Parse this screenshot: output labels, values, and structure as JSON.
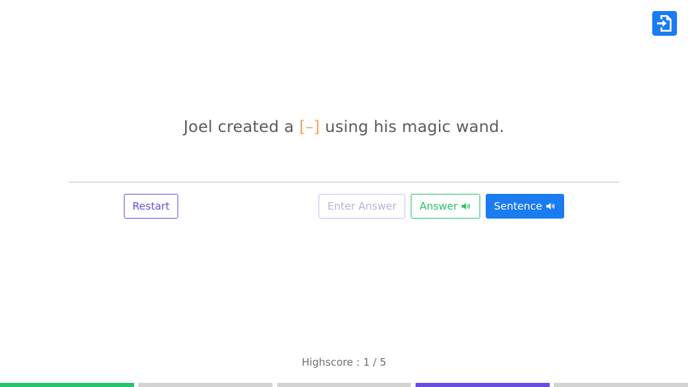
{
  "sentence": {
    "before": "Joel created a ",
    "blank": "[–]",
    "after": " using his magic wand."
  },
  "buttons": {
    "restart_label": "Restart",
    "answer_label": "Answer",
    "sentence_label": "Sentence"
  },
  "answer_input": {
    "placeholder": "Enter Answer",
    "value": ""
  },
  "highscore": {
    "text": "Highscore : 1 / 5",
    "current": 1,
    "total": 5
  },
  "progress_segments": [
    {
      "status": "correct",
      "color": "#27c36a"
    },
    {
      "status": "pending",
      "color": "#d3d3d3"
    },
    {
      "status": "pending",
      "color": "#d3d3d3"
    },
    {
      "status": "current",
      "color": "#6a4ce0"
    },
    {
      "status": "pending",
      "color": "#d3d3d3"
    }
  ],
  "icons": {
    "exit": "exit-icon",
    "answer_speaker": "speaker-icon",
    "sentence_speaker": "speaker-icon"
  },
  "colors": {
    "primary": "#1a7cf0",
    "accent_purple": "#6a4ce0",
    "success": "#27c36a",
    "blank": "#f5a05a"
  }
}
